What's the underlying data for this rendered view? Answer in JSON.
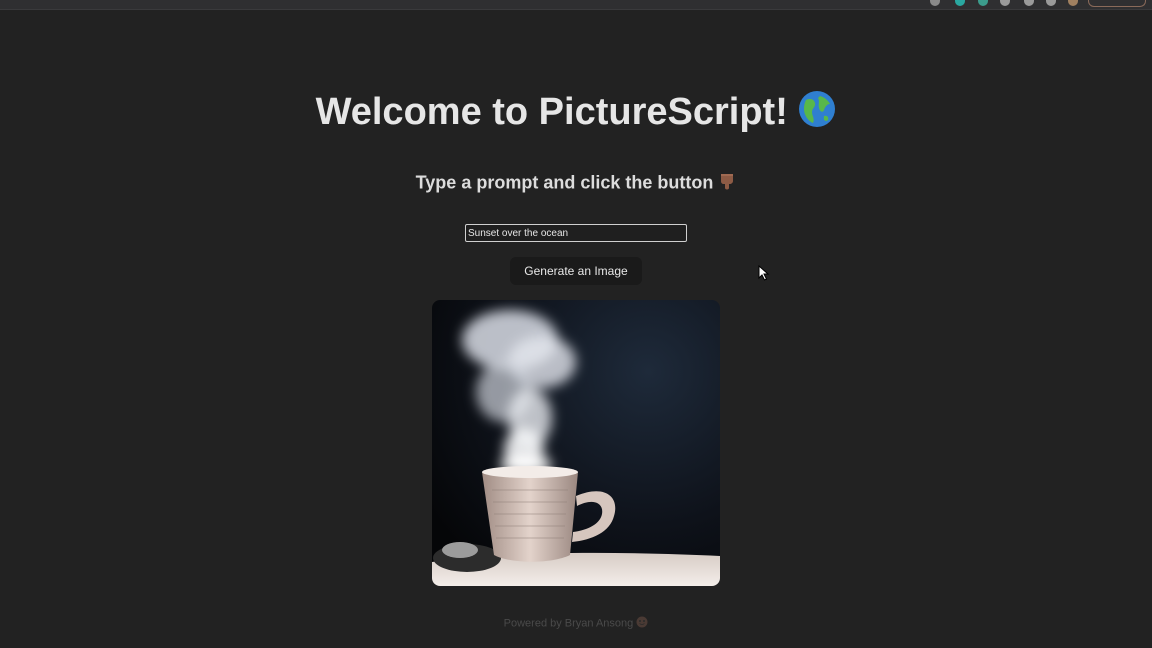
{
  "header": {
    "title": "Welcome to PictureScript!",
    "subtitle": "Type a prompt and click the button"
  },
  "prompt": {
    "value": "Sunset over the ocean"
  },
  "generate_button": {
    "label": "Generate an Image"
  },
  "footer": {
    "text": "Powered by Bryan Ansong"
  },
  "icons": {
    "title": "globe-icon",
    "subtitle": "pointing-down-hand-icon",
    "footer": "face-emoji-icon"
  },
  "colors": {
    "background": "#222222",
    "button": "#1a1a1a"
  }
}
